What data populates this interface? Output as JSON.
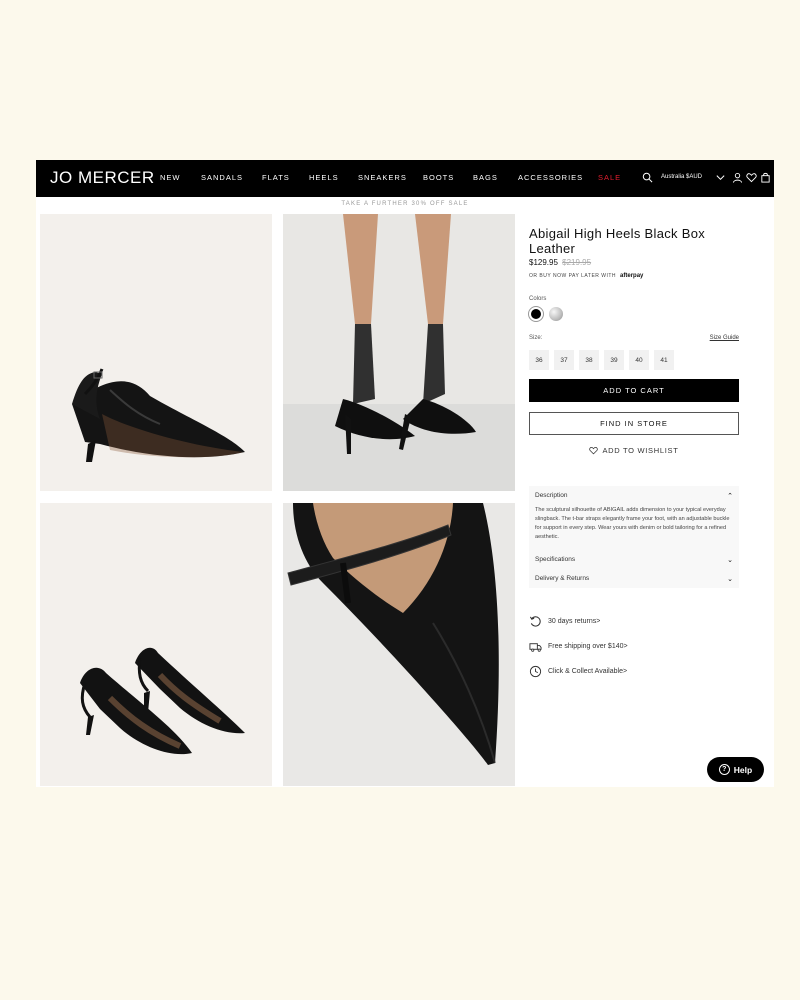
{
  "header": {
    "logo": "JO MERCER",
    "nav": [
      "NEW",
      "SANDALS",
      "FLATS",
      "HEELS",
      "SNEAKERS",
      "BOOTS",
      "BAGS",
      "ACCESSORIES",
      "SALE"
    ],
    "region": "Australia $AUD",
    "icons": [
      "search-icon",
      "chevron-down-icon",
      "account-icon",
      "wishlist-icon",
      "bag-icon"
    ]
  },
  "promo": "TAKE A FURTHER 30% OFF SALE",
  "product": {
    "title": "Abigail High Heels Black Box Leather",
    "price": "$129.95",
    "old_price": "$219.95",
    "bnpl": "OR BUY NOW PAY LATER WITH",
    "bnpl_brand": "afterpay",
    "colors_label": "Colors",
    "colors": [
      "#000000",
      "#c0c0c0"
    ],
    "size_label": "Size:",
    "size_guide": "Size Guide",
    "sizes": [
      "36",
      "37",
      "38",
      "39",
      "40",
      "41"
    ],
    "add_to_cart": "ADD TO CART",
    "find_in_store": "FIND IN STORE",
    "wishlist": "ADD TO WISHLIST"
  },
  "accordion": {
    "description_title": "Description",
    "description_text": "The sculptural silhouette of ABIGAIL adds dimension to your typical everyday slingback. The t-bar straps elegantly frame your foot, with an adjustable buckle for support in every step. Wear yours with denim or bold tailoring for a refined aesthetic.",
    "specifications_title": "Specifications",
    "delivery_title": "Delivery & Returns"
  },
  "perks": [
    "30 days returns>",
    "Free shipping over $140>",
    "Click & Collect Available>"
  ],
  "help": "Help"
}
